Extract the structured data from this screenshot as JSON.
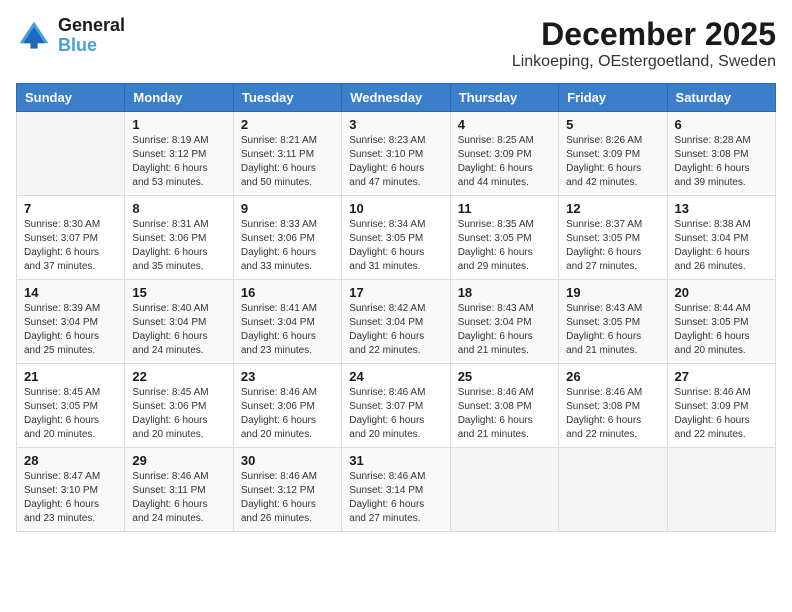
{
  "header": {
    "logo_line1": "General",
    "logo_line2": "Blue",
    "month": "December 2025",
    "location": "Linkoeping, OEstergoetland, Sweden"
  },
  "weekdays": [
    "Sunday",
    "Monday",
    "Tuesday",
    "Wednesday",
    "Thursday",
    "Friday",
    "Saturday"
  ],
  "weeks": [
    [
      {
        "day": "",
        "info": ""
      },
      {
        "day": "1",
        "info": "Sunrise: 8:19 AM\nSunset: 3:12 PM\nDaylight: 6 hours\nand 53 minutes."
      },
      {
        "day": "2",
        "info": "Sunrise: 8:21 AM\nSunset: 3:11 PM\nDaylight: 6 hours\nand 50 minutes."
      },
      {
        "day": "3",
        "info": "Sunrise: 8:23 AM\nSunset: 3:10 PM\nDaylight: 6 hours\nand 47 minutes."
      },
      {
        "day": "4",
        "info": "Sunrise: 8:25 AM\nSunset: 3:09 PM\nDaylight: 6 hours\nand 44 minutes."
      },
      {
        "day": "5",
        "info": "Sunrise: 8:26 AM\nSunset: 3:09 PM\nDaylight: 6 hours\nand 42 minutes."
      },
      {
        "day": "6",
        "info": "Sunrise: 8:28 AM\nSunset: 3:08 PM\nDaylight: 6 hours\nand 39 minutes."
      }
    ],
    [
      {
        "day": "7",
        "info": "Sunrise: 8:30 AM\nSunset: 3:07 PM\nDaylight: 6 hours\nand 37 minutes."
      },
      {
        "day": "8",
        "info": "Sunrise: 8:31 AM\nSunset: 3:06 PM\nDaylight: 6 hours\nand 35 minutes."
      },
      {
        "day": "9",
        "info": "Sunrise: 8:33 AM\nSunset: 3:06 PM\nDaylight: 6 hours\nand 33 minutes."
      },
      {
        "day": "10",
        "info": "Sunrise: 8:34 AM\nSunset: 3:05 PM\nDaylight: 6 hours\nand 31 minutes."
      },
      {
        "day": "11",
        "info": "Sunrise: 8:35 AM\nSunset: 3:05 PM\nDaylight: 6 hours\nand 29 minutes."
      },
      {
        "day": "12",
        "info": "Sunrise: 8:37 AM\nSunset: 3:05 PM\nDaylight: 6 hours\nand 27 minutes."
      },
      {
        "day": "13",
        "info": "Sunrise: 8:38 AM\nSunset: 3:04 PM\nDaylight: 6 hours\nand 26 minutes."
      }
    ],
    [
      {
        "day": "14",
        "info": "Sunrise: 8:39 AM\nSunset: 3:04 PM\nDaylight: 6 hours\nand 25 minutes."
      },
      {
        "day": "15",
        "info": "Sunrise: 8:40 AM\nSunset: 3:04 PM\nDaylight: 6 hours\nand 24 minutes."
      },
      {
        "day": "16",
        "info": "Sunrise: 8:41 AM\nSunset: 3:04 PM\nDaylight: 6 hours\nand 23 minutes."
      },
      {
        "day": "17",
        "info": "Sunrise: 8:42 AM\nSunset: 3:04 PM\nDaylight: 6 hours\nand 22 minutes."
      },
      {
        "day": "18",
        "info": "Sunrise: 8:43 AM\nSunset: 3:04 PM\nDaylight: 6 hours\nand 21 minutes."
      },
      {
        "day": "19",
        "info": "Sunrise: 8:43 AM\nSunset: 3:05 PM\nDaylight: 6 hours\nand 21 minutes."
      },
      {
        "day": "20",
        "info": "Sunrise: 8:44 AM\nSunset: 3:05 PM\nDaylight: 6 hours\nand 20 minutes."
      }
    ],
    [
      {
        "day": "21",
        "info": "Sunrise: 8:45 AM\nSunset: 3:05 PM\nDaylight: 6 hours\nand 20 minutes."
      },
      {
        "day": "22",
        "info": "Sunrise: 8:45 AM\nSunset: 3:06 PM\nDaylight: 6 hours\nand 20 minutes."
      },
      {
        "day": "23",
        "info": "Sunrise: 8:46 AM\nSunset: 3:06 PM\nDaylight: 6 hours\nand 20 minutes."
      },
      {
        "day": "24",
        "info": "Sunrise: 8:46 AM\nSunset: 3:07 PM\nDaylight: 6 hours\nand 20 minutes."
      },
      {
        "day": "25",
        "info": "Sunrise: 8:46 AM\nSunset: 3:08 PM\nDaylight: 6 hours\nand 21 minutes."
      },
      {
        "day": "26",
        "info": "Sunrise: 8:46 AM\nSunset: 3:08 PM\nDaylight: 6 hours\nand 22 minutes."
      },
      {
        "day": "27",
        "info": "Sunrise: 8:46 AM\nSunset: 3:09 PM\nDaylight: 6 hours\nand 22 minutes."
      }
    ],
    [
      {
        "day": "28",
        "info": "Sunrise: 8:47 AM\nSunset: 3:10 PM\nDaylight: 6 hours\nand 23 minutes."
      },
      {
        "day": "29",
        "info": "Sunrise: 8:46 AM\nSunset: 3:11 PM\nDaylight: 6 hours\nand 24 minutes."
      },
      {
        "day": "30",
        "info": "Sunrise: 8:46 AM\nSunset: 3:12 PM\nDaylight: 6 hours\nand 26 minutes."
      },
      {
        "day": "31",
        "info": "Sunrise: 8:46 AM\nSunset: 3:14 PM\nDaylight: 6 hours\nand 27 minutes."
      },
      {
        "day": "",
        "info": ""
      },
      {
        "day": "",
        "info": ""
      },
      {
        "day": "",
        "info": ""
      }
    ]
  ]
}
